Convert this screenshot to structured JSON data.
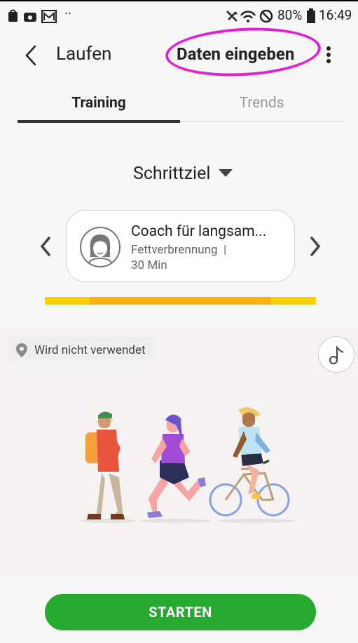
{
  "status_bar": {
    "battery": "80%",
    "time": "16:49",
    "dots": "··"
  },
  "header": {
    "title": "Laufen",
    "action": "Daten eingeben"
  },
  "tabs": [
    {
      "label": "Training"
    },
    {
      "label": "Trends"
    }
  ],
  "goal": {
    "label": "Schrittziel"
  },
  "program": {
    "title": "Coach für langsam...",
    "line1": "Fettverbrennung  |",
    "line2": "30 Min"
  },
  "intensity_bar": {
    "colors": [
      "#f8d100",
      "#fbb20f",
      "#f8d100"
    ]
  },
  "location": {
    "label": "Wird nicht verwendet"
  },
  "start_button": {
    "label": "STARTEN"
  },
  "colors": {
    "accent_green": "#27a82e",
    "highlight_magenta": "#e020d8",
    "background": "#f7f7f7"
  }
}
